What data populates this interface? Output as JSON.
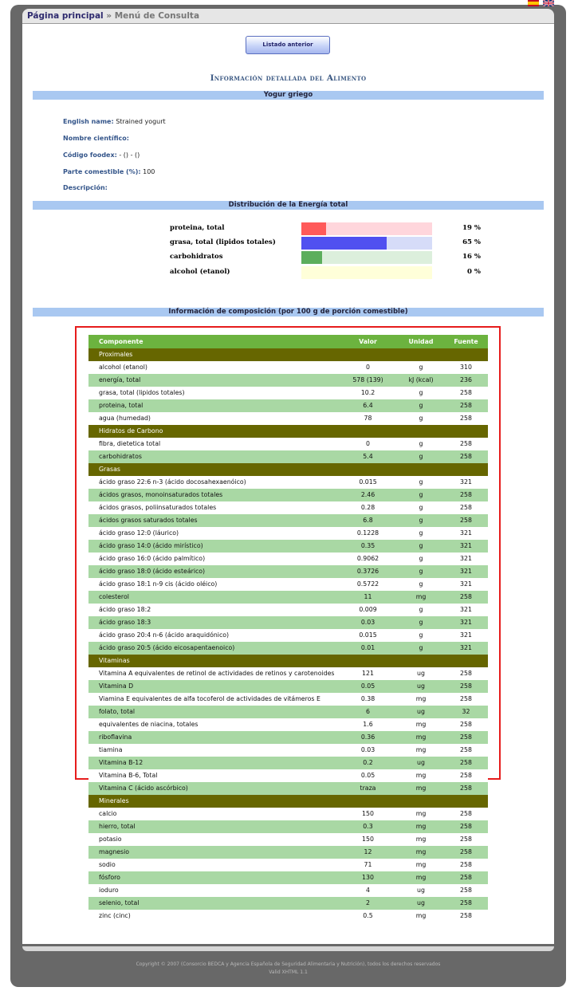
{
  "breadcrumb": {
    "home": "Página principal",
    "sep": " » ",
    "current": "Menú de Consulta"
  },
  "flags": [
    {
      "icon": "spain-flag-icon"
    },
    {
      "icon": "uk-flag-icon"
    }
  ],
  "button_prev": "Listado anterior",
  "title": "Información detallada del Alimento",
  "food_name": "Yogur griego",
  "info": [
    {
      "label": "English name:",
      "value": " Strained yogurt"
    },
    {
      "label": "Nombre científico:",
      "value": ""
    },
    {
      "label": "Código foodex:",
      "value": " - () - ()"
    },
    {
      "label": "Parte comestible (%):",
      "value": " 100"
    },
    {
      "label": "Descripción:",
      "value": ""
    }
  ],
  "energy_title": "Distribución de la Energía total",
  "energy": [
    {
      "label": "proteina, total",
      "percent": 19,
      "text": "19 %",
      "color": "#ff5a5a",
      "bg": "#ffd6dc"
    },
    {
      "label": "grasa, total (lipidos totales)",
      "percent": 65,
      "text": "65 %",
      "color": "#5050f0",
      "bg": "#d6dcf8"
    },
    {
      "label": "carbohidratos",
      "percent": 16,
      "text": "16 %",
      "color": "#5cae5c",
      "bg": "#dcefdc"
    },
    {
      "label": "alcohol (etanol)",
      "percent": 0,
      "text": "0 %",
      "color": "#e8e8a0",
      "bg": "#ffffd9"
    }
  ],
  "composition_title": "Información de composición (por 100 g de porción comestible)",
  "table": {
    "headers": [
      "Componente",
      "Valor",
      "Unidad",
      "Fuente"
    ],
    "rows": [
      {
        "g": "Proximales"
      },
      {
        "n": "alcohol (etanol)",
        "v": "0",
        "u": "g",
        "f": "310"
      },
      {
        "n": "energía, total",
        "v": "578 (139)",
        "u": "kJ (kcal)",
        "f": "236"
      },
      {
        "n": "grasa, total (lipidos totales)",
        "v": "10.2",
        "u": "g",
        "f": "258"
      },
      {
        "n": "proteina, total",
        "v": "6.4",
        "u": "g",
        "f": "258"
      },
      {
        "n": "agua (humedad)",
        "v": "78",
        "u": "g",
        "f": "258"
      },
      {
        "g": "Hidratos de Carbono"
      },
      {
        "n": "fibra, dietetica total",
        "v": "0",
        "u": "g",
        "f": "258"
      },
      {
        "n": "carbohidratos",
        "v": "5.4",
        "u": "g",
        "f": "258"
      },
      {
        "g": "Grasas"
      },
      {
        "n": "ácido graso 22:6 n-3 (ácido docosahexaenóico)",
        "v": "0.015",
        "u": "g",
        "f": "321"
      },
      {
        "n": "ácidos grasos, monoinsaturados totales",
        "v": "2.46",
        "u": "g",
        "f": "258"
      },
      {
        "n": "ácidos grasos, poliinsaturados totales",
        "v": "0.28",
        "u": "g",
        "f": "258"
      },
      {
        "n": "ácidos grasos saturados totales",
        "v": "6.8",
        "u": "g",
        "f": "258"
      },
      {
        "n": "ácido graso 12:0 (láurico)",
        "v": "0.1228",
        "u": "g",
        "f": "321"
      },
      {
        "n": "ácido graso 14:0 (ácido mirístico)",
        "v": "0.35",
        "u": "g",
        "f": "321"
      },
      {
        "n": "ácido graso 16:0 (ácido palmítico)",
        "v": "0.9062",
        "u": "g",
        "f": "321"
      },
      {
        "n": "ácido graso 18:0 (ácido esteárico)",
        "v": "0.3726",
        "u": "g",
        "f": "321"
      },
      {
        "n": "ácido graso 18:1 n-9 cis (ácido oléico)",
        "v": "0.5722",
        "u": "g",
        "f": "321"
      },
      {
        "n": "colesterol",
        "v": "11",
        "u": "mg",
        "f": "258"
      },
      {
        "n": "ácido graso 18:2",
        "v": "0.009",
        "u": "g",
        "f": "321"
      },
      {
        "n": "ácido graso 18:3",
        "v": "0.03",
        "u": "g",
        "f": "321"
      },
      {
        "n": "ácido graso 20:4 n-6 (ácido araquidónico)",
        "v": "0.015",
        "u": "g",
        "f": "321"
      },
      {
        "n": "ácido graso 20:5 (ácido eicosapentaenoico)",
        "v": "0.01",
        "u": "g",
        "f": "321"
      },
      {
        "g": "Vitaminas"
      },
      {
        "n": "Vitamina A equivalentes de retinol de actividades de retinos y carotenoides",
        "v": "121",
        "u": "ug",
        "f": "258"
      },
      {
        "n": "Vitamina D",
        "v": "0.05",
        "u": "ug",
        "f": "258"
      },
      {
        "n": "Viamina E equivalentes de alfa tocoferol de actividades de vitámeros E",
        "v": "0.38",
        "u": "mg",
        "f": "258"
      },
      {
        "n": "folato, total",
        "v": "6",
        "u": "ug",
        "f": "32"
      },
      {
        "n": "equivalentes de niacina, totales",
        "v": "1.6",
        "u": "mg",
        "f": "258"
      },
      {
        "n": "riboflavina",
        "v": "0.36",
        "u": "mg",
        "f": "258"
      },
      {
        "n": "tiamina",
        "v": "0.03",
        "u": "mg",
        "f": "258"
      },
      {
        "n": "Vitamina B-12",
        "v": "0.2",
        "u": "ug",
        "f": "258"
      },
      {
        "n": "Vitamina B-6, Total",
        "v": "0.05",
        "u": "mg",
        "f": "258"
      },
      {
        "n": "Vitamina C (ácido ascórbico)",
        "v": "traza",
        "u": "mg",
        "f": "258"
      },
      {
        "g": "Minerales"
      },
      {
        "n": "calcio",
        "v": "150",
        "u": "mg",
        "f": "258"
      },
      {
        "n": "hierro, total",
        "v": "0.3",
        "u": "mg",
        "f": "258"
      },
      {
        "n": "potasio",
        "v": "150",
        "u": "mg",
        "f": "258"
      },
      {
        "n": "magnesio",
        "v": "12",
        "u": "mg",
        "f": "258"
      },
      {
        "n": "sodio",
        "v": "71",
        "u": "mg",
        "f": "258"
      },
      {
        "n": "fósforo",
        "v": "130",
        "u": "mg",
        "f": "258"
      },
      {
        "n": "ioduro",
        "v": "4",
        "u": "ug",
        "f": "258"
      },
      {
        "n": "selenio, total",
        "v": "2",
        "u": "ug",
        "f": "258"
      },
      {
        "n": "zinc (cinc)",
        "v": "0.5",
        "u": "mg",
        "f": "258"
      }
    ]
  },
  "footer": {
    "copyright": "Copyright © 2007 (Consorcio BEDCA y Agencia Española de Seguridad Alimentaria y Nutrición), todos los derechos reservados",
    "valid": "Valid XHTML 1.1"
  }
}
